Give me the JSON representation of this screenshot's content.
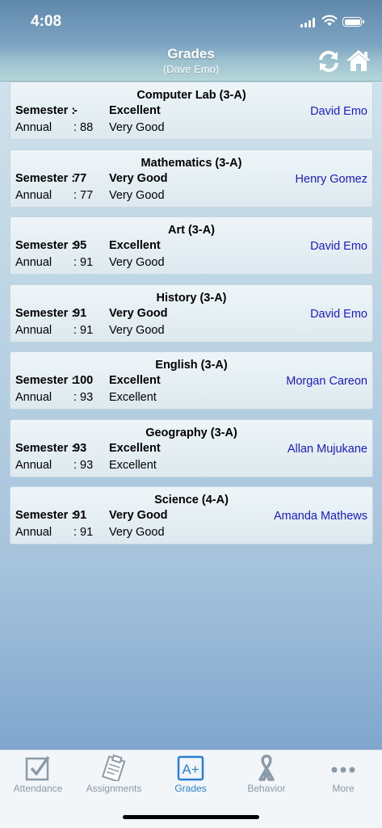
{
  "status_bar": {
    "time": "4:08"
  },
  "header": {
    "title": "Grades",
    "subtitle": "(Dave Emo)"
  },
  "grades": [
    {
      "subject": "Computer Lab (3-A)",
      "semester_label": "Semester :",
      "semester_value": "-",
      "semester_grade": "Excellent",
      "annual_label": "Annual",
      "annual_value": ": 88",
      "annual_grade": "Very Good",
      "teacher": "David Emo"
    },
    {
      "subject": "Mathematics  (3-A)",
      "semester_label": "Semester :",
      "semester_value": "77",
      "semester_grade": "Very Good",
      "annual_label": "Annual",
      "annual_value": ": 77",
      "annual_grade": "Very Good",
      "teacher": "Henry Gomez"
    },
    {
      "subject": "Art (3-A)",
      "semester_label": "Semester :",
      "semester_value": "95",
      "semester_grade": "Excellent",
      "annual_label": "Annual",
      "annual_value": ": 91",
      "annual_grade": "Very Good",
      "teacher": "David Emo"
    },
    {
      "subject": "History (3-A)",
      "semester_label": "Semester :",
      "semester_value": "91",
      "semester_grade": "Very Good",
      "annual_label": "Annual",
      "annual_value": ": 91",
      "annual_grade": "Very Good",
      "teacher": "David Emo"
    },
    {
      "subject": "English (3-A)",
      "semester_label": "Semester :",
      "semester_value": "100",
      "semester_grade": "Excellent",
      "annual_label": "Annual",
      "annual_value": ": 93",
      "annual_grade": "Excellent",
      "teacher": "Morgan Careon"
    },
    {
      "subject": "Geography (3-A)",
      "semester_label": "Semester :",
      "semester_value": "93",
      "semester_grade": "Excellent",
      "annual_label": "Annual",
      "annual_value": ": 93",
      "annual_grade": "Excellent",
      "teacher": "Allan Mujukane"
    },
    {
      "subject": "Science (4-A)",
      "semester_label": "Semester :",
      "semester_value": "91",
      "semester_grade": "Very Good",
      "annual_label": "Annual",
      "annual_value": ": 91",
      "annual_grade": "Very Good",
      "teacher": "Amanda Mathews"
    }
  ],
  "tabs": [
    {
      "label": "Attendance",
      "icon": "checkbox-icon",
      "active": false
    },
    {
      "label": "Assignments",
      "icon": "clipboard-icon",
      "active": false
    },
    {
      "label": "Grades",
      "icon": "a-plus-icon",
      "active": true
    },
    {
      "label": "Behavior",
      "icon": "ribbon-icon",
      "active": false
    },
    {
      "label": "More",
      "icon": "more-dots-icon",
      "active": false
    }
  ],
  "colors": {
    "accent": "#2a7fd3",
    "teacher_link": "#1a1acc",
    "tab_inactive": "#8a9aa8"
  }
}
